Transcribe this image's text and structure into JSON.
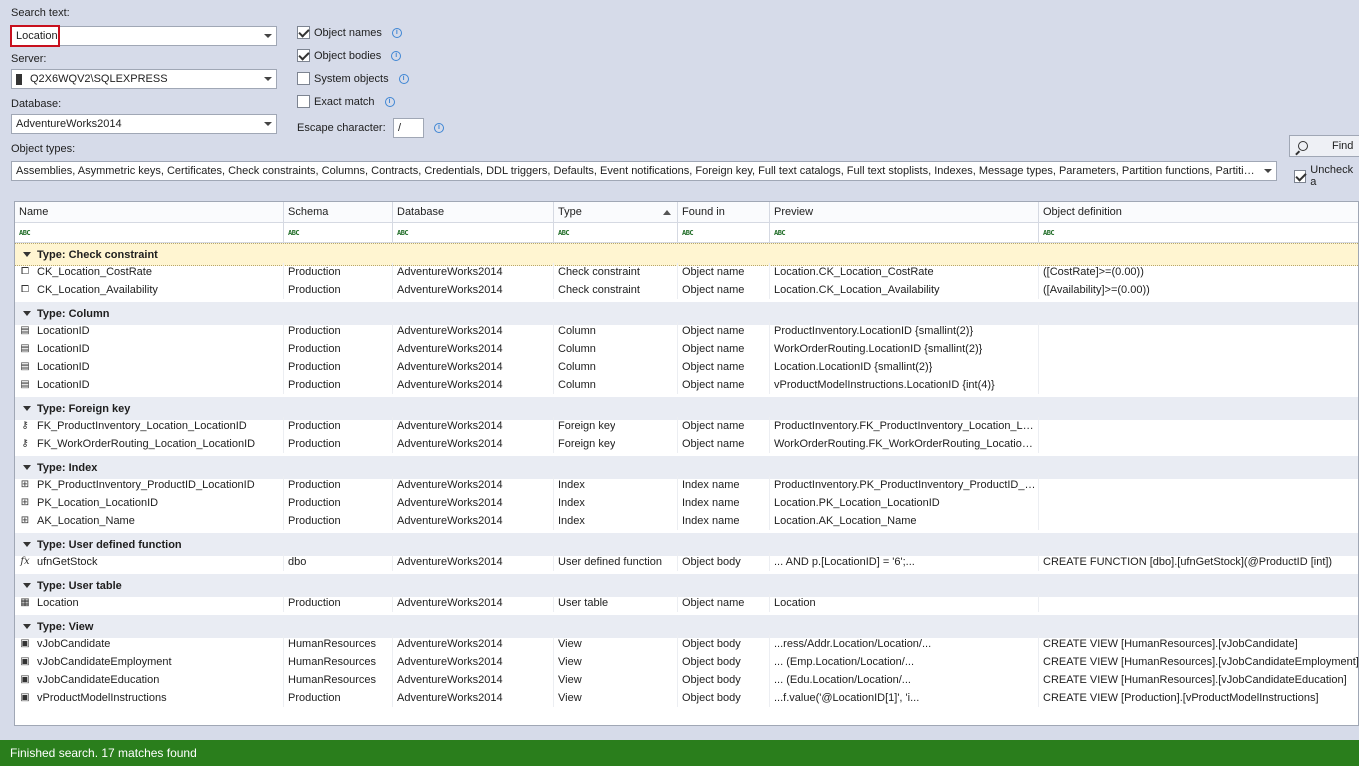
{
  "search": {
    "label": "Search text:",
    "value": "Location",
    "server_label": "Server:",
    "server_value": "Q2X6WQV2\\SQLEXPRESS",
    "database_label": "Database:",
    "database_value": "AdventureWorks2014",
    "object_types_label": "Object types:",
    "object_types_value": "Assemblies, Asymmetric keys, Certificates, Check constraints, Columns, Contracts, Credentials, DDL triggers, Defaults, Event notifications, Foreign key, Full text catalogs, Full text stoplists, Indexes, Message types, Parameters, Partition functions, Partition schemes..."
  },
  "options": {
    "object_names": {
      "label": "Object names",
      "checked": true
    },
    "object_bodies": {
      "label": "Object bodies",
      "checked": true
    },
    "system_objects": {
      "label": "System objects",
      "checked": false
    },
    "exact_match": {
      "label": "Exact match",
      "checked": false
    },
    "escape_label": "Escape character:",
    "escape_value": "/",
    "info_glyph": "i",
    "uncheck_label": "Uncheck a"
  },
  "find_label": "Find",
  "grid": {
    "columns": [
      "Name",
      "Schema",
      "Database",
      "Type",
      "Found in",
      "Preview",
      "Object definition"
    ],
    "filter_glyph": "ABC",
    "groups": [
      {
        "title": "Type: Check constraint",
        "rows": [
          {
            "icon": "check-constraint-icon",
            "glyph": "⧠",
            "cells": [
              "CK_Location_CostRate",
              "Production",
              "AdventureWorks2014",
              "Check constraint",
              "Object name",
              "Location.CK_Location_CostRate",
              "([CostRate]>=(0.00))"
            ]
          },
          {
            "icon": "check-constraint-icon",
            "glyph": "⧠",
            "cells": [
              "CK_Location_Availability",
              "Production",
              "AdventureWorks2014",
              "Check constraint",
              "Object name",
              "Location.CK_Location_Availability",
              "([Availability]>=(0.00))"
            ]
          }
        ]
      },
      {
        "title": "Type: Column",
        "rows": [
          {
            "icon": "column-icon",
            "glyph": "▤",
            "cells": [
              "LocationID",
              "Production",
              "AdventureWorks2014",
              "Column",
              "Object name",
              "ProductInventory.LocationID {smallint(2)}",
              ""
            ]
          },
          {
            "icon": "column-icon",
            "glyph": "▤",
            "cells": [
              "LocationID",
              "Production",
              "AdventureWorks2014",
              "Column",
              "Object name",
              "WorkOrderRouting.LocationID {smallint(2)}",
              ""
            ]
          },
          {
            "icon": "column-icon",
            "glyph": "▤",
            "cells": [
              "LocationID",
              "Production",
              "AdventureWorks2014",
              "Column",
              "Object name",
              "Location.LocationID {smallint(2)}",
              ""
            ]
          },
          {
            "icon": "column-icon",
            "glyph": "▤",
            "cells": [
              "LocationID",
              "Production",
              "AdventureWorks2014",
              "Column",
              "Object name",
              "vProductModelInstructions.LocationID {int(4)}",
              ""
            ]
          }
        ]
      },
      {
        "title": "Type: Foreign key",
        "rows": [
          {
            "icon": "key-icon",
            "glyph": "⚷",
            "cells": [
              "FK_ProductInventory_Location_LocationID",
              "Production",
              "AdventureWorks2014",
              "Foreign key",
              "Object name",
              "ProductInventory.FK_ProductInventory_Location_LocationID",
              ""
            ]
          },
          {
            "icon": "key-icon",
            "glyph": "⚷",
            "cells": [
              "FK_WorkOrderRouting_Location_LocationID",
              "Production",
              "AdventureWorks2014",
              "Foreign key",
              "Object name",
              "WorkOrderRouting.FK_WorkOrderRouting_Location_LocationID",
              ""
            ]
          }
        ]
      },
      {
        "title": "Type: Index",
        "rows": [
          {
            "icon": "index-icon",
            "glyph": "⊞",
            "cells": [
              "PK_ProductInventory_ProductID_LocationID",
              "Production",
              "AdventureWorks2014",
              "Index",
              "Index name",
              "ProductInventory.PK_ProductInventory_ProductID_LocationID",
              ""
            ]
          },
          {
            "icon": "index-icon",
            "glyph": "⊞",
            "cells": [
              "PK_Location_LocationID",
              "Production",
              "AdventureWorks2014",
              "Index",
              "Index name",
              "Location.PK_Location_LocationID",
              ""
            ]
          },
          {
            "icon": "index-icon",
            "glyph": "⊞",
            "cells": [
              "AK_Location_Name",
              "Production",
              "AdventureWorks2014",
              "Index",
              "Index name",
              "Location.AK_Location_Name",
              ""
            ]
          }
        ]
      },
      {
        "title": "Type: User defined function",
        "rows": [
          {
            "icon": "function-icon",
            "glyph": "fx",
            "cells": [
              "ufnGetStock",
              "dbo",
              "AdventureWorks2014",
              "User defined function",
              "Object body",
              "...    AND p.[LocationID] = '6';...",
              "CREATE FUNCTION [dbo].[ufnGetStock](@ProductID [int])"
            ]
          }
        ]
      },
      {
        "title": "Type: User table",
        "rows": [
          {
            "icon": "table-icon",
            "glyph": "▦",
            "cells": [
              "Location",
              "Production",
              "AdventureWorks2014",
              "User table",
              "Object name",
              "Location",
              ""
            ]
          }
        ]
      },
      {
        "title": "Type: View",
        "rows": [
          {
            "icon": "view-icon",
            "glyph": "▣",
            "cells": [
              "vJobCandidate",
              "HumanResources",
              "AdventureWorks2014",
              "View",
              "Object body",
              "...ress/Addr.Location/Location/...",
              "CREATE VIEW [HumanResources].[vJobCandidate]"
            ]
          },
          {
            "icon": "view-icon",
            "glyph": "▣",
            "cells": [
              "vJobCandidateEmployment",
              "HumanResources",
              "AdventureWorks2014",
              "View",
              "Object body",
              "...     (Emp.Location/Location/...",
              "CREATE VIEW [HumanResources].[vJobCandidateEmployment]"
            ]
          },
          {
            "icon": "view-icon",
            "glyph": "▣",
            "cells": [
              "vJobCandidateEducation",
              "HumanResources",
              "AdventureWorks2014",
              "View",
              "Object body",
              "...     (Edu.Location/Location/...",
              "CREATE VIEW [HumanResources].[vJobCandidateEducation]"
            ]
          },
          {
            "icon": "view-icon",
            "glyph": "▣",
            "cells": [
              "vProductModelInstructions",
              "Production",
              "AdventureWorks2014",
              "View",
              "Object body",
              "...f.value('@LocationID[1]', 'i...",
              "CREATE VIEW [Production].[vProductModelInstructions]"
            ]
          }
        ]
      }
    ]
  },
  "status": "Finished search. 17 matches found",
  "colors": {
    "status_bg": "#2a7e1c",
    "highlight_border": "#c8101e",
    "first_group_bg": "#fff5d1"
  }
}
